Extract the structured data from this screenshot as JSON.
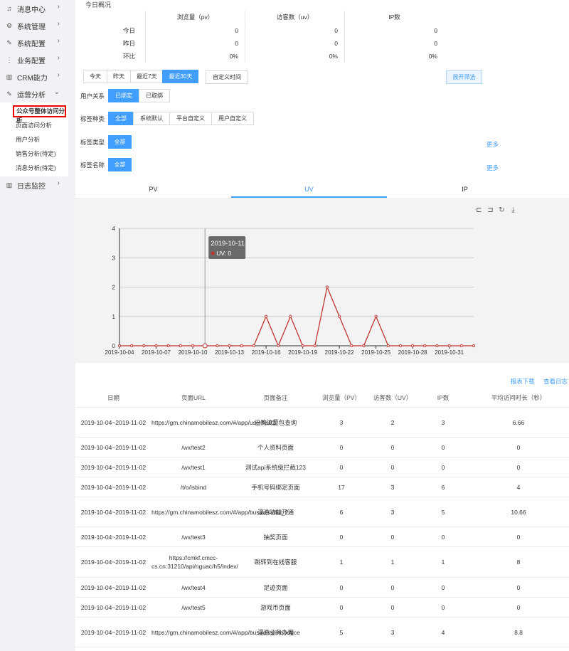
{
  "sidebar": {
    "items": [
      {
        "icon": "bell-icon",
        "label": "消息中心"
      },
      {
        "icon": "gear-icon",
        "label": "系统管理"
      },
      {
        "icon": "edit-icon",
        "label": "系统配置"
      },
      {
        "icon": "more-vertical-icon",
        "label": "业务配置"
      },
      {
        "icon": "book-icon",
        "label": "CRM能力"
      },
      {
        "icon": "edit-icon",
        "label": "运营分析"
      }
    ],
    "sub_items": [
      "公众号整体访问分析",
      "页面访问分析",
      "用户分析",
      "销售分析(待定)",
      "消息分析(待定)"
    ],
    "last_item": {
      "icon": "book-icon",
      "label": "日志监控"
    }
  },
  "overview": {
    "title": "今日概况",
    "headers": [
      "浏览量（pv）",
      "访客数（uv）",
      "IP数"
    ],
    "rows": [
      {
        "label": "今日",
        "values": [
          "0",
          "0",
          "0"
        ]
      },
      {
        "label": "昨日",
        "values": [
          "0",
          "0",
          "0"
        ]
      },
      {
        "label": "环比",
        "values": [
          "0%",
          "0%",
          "0%"
        ]
      }
    ]
  },
  "date_range": {
    "buttons": [
      "今天",
      "昨天",
      "最近7天",
      "最近30天"
    ],
    "selected": "最近30天",
    "custom": "自定义时间",
    "expand": "展开筛选"
  },
  "filters": {
    "relation": {
      "label": "用户关系",
      "options": [
        "已绑定",
        "已取绑"
      ]
    },
    "tag_kind": {
      "label": "标签种类",
      "options": [
        "全部",
        "系统默认",
        "平台自定义",
        "用户自定义"
      ]
    },
    "tag_type": {
      "label": "标签类型",
      "options": [
        "全部"
      ],
      "more": "更多"
    },
    "tag_name": {
      "label": "标签名称",
      "options": [
        "全部"
      ],
      "more": "更多"
    }
  },
  "tabs": [
    "PV",
    "UV",
    "IP"
  ],
  "tooltip": {
    "date": "2019-10-11",
    "text": "UV: 0"
  },
  "chart_data": {
    "type": "line",
    "x": [
      "2019-10-04",
      "2019-10-05",
      "2019-10-06",
      "2019-10-07",
      "2019-10-08",
      "2019-10-09",
      "2019-10-10",
      "2019-10-11",
      "2019-10-12",
      "2019-10-13",
      "2019-10-14",
      "2019-10-15",
      "2019-10-16",
      "2019-10-17",
      "2019-10-18",
      "2019-10-19",
      "2019-10-20",
      "2019-10-21",
      "2019-10-22",
      "2019-10-23",
      "2019-10-24",
      "2019-10-25",
      "2019-10-26",
      "2019-10-27",
      "2019-10-28",
      "2019-10-29",
      "2019-10-30",
      "2019-10-31",
      "2019-11-01",
      "2019-11-02"
    ],
    "xticks": [
      "2019-10-04",
      "2019-10-07",
      "2019-10-10",
      "2019-10-13",
      "2019-10-16",
      "2019-10-19",
      "2019-10-22",
      "2019-10-25",
      "2019-10-28",
      "2019-10-31"
    ],
    "series": [
      {
        "values": [
          0,
          0,
          0,
          0,
          0,
          0,
          0,
          0,
          0,
          0,
          0,
          0,
          1,
          0,
          1,
          0,
          0,
          2,
          1,
          0,
          0,
          1,
          0,
          0,
          0,
          0,
          0,
          0,
          0,
          0
        ]
      }
    ],
    "ylim": [
      0,
      4
    ],
    "yticks": [
      0,
      1,
      2,
      3,
      4
    ],
    "color": "#c23531",
    "highlight": "2019-10-11"
  },
  "table_links": [
    "报表下载",
    "查看日志"
  ],
  "table": {
    "headers": [
      "日期",
      "页面URL",
      "页面备注",
      "浏览量（PV）",
      "访客数（UV）",
      "IP数",
      "平均访问时长（秒）"
    ],
    "rows": [
      [
        "2019-10-04~2019-11-02",
        "https://gm.chinamobilesz.com/#/app/user/list/2",
        "已购流量包查询",
        "3",
        "2",
        "3",
        "6.66"
      ],
      [
        "2019-10-04~2019-11-02",
        "/wx/test2",
        "个人资料页面",
        "0",
        "0",
        "0",
        "0"
      ],
      [
        "2019-10-04~2019-11-02",
        "/wx/test1",
        "测试api系统级拦截123",
        "0",
        "0",
        "0",
        "0"
      ],
      [
        "2019-10-04~2019-11-02",
        "/t/o/isbind",
        "手机号码绑定页面",
        "17",
        "3",
        "6",
        "4"
      ],
      [
        "2019-10-04~2019-11-02",
        "https://gm.chinamobilesz.com/#/app/business/ful_2",
        "漫游功能开通",
        "6",
        "3",
        "5",
        "10.66"
      ],
      [
        "2019-10-04~2019-11-02",
        "/wx/test3",
        "抽奖页面",
        "0",
        "0",
        "0",
        "0"
      ],
      [
        "2019-10-04~2019-11-02",
        "https://cmkf.cmcc-cs.cn:31210/api/nguac/h5/index/",
        "跳转到在线客服",
        "1",
        "1",
        "1",
        "8"
      ],
      [
        "2019-10-04~2019-11-02",
        "/wx/test4",
        "足迹页面",
        "0",
        "0",
        "0",
        "0"
      ],
      [
        "2019-10-04~2019-11-02",
        "/wx/test5",
        "游戏币页面",
        "0",
        "0",
        "0",
        "0"
      ],
      [
        "2019-10-04~2019-11-02",
        "https://gm.chinamobilesz.com/#/app/business/introduce",
        "漫游业务办理",
        "5",
        "3",
        "4",
        "8.8"
      ]
    ]
  }
}
